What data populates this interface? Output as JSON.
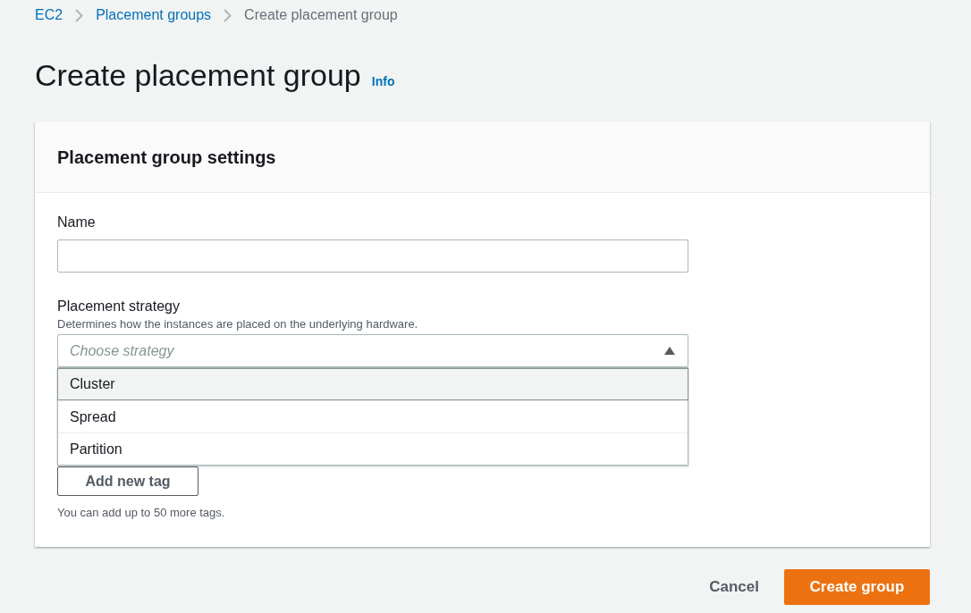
{
  "breadcrumb": [
    {
      "label": "EC2",
      "link": true
    },
    {
      "label": "Placement groups",
      "link": true
    },
    {
      "label": "Create placement group",
      "link": false
    }
  ],
  "title": "Create placement group",
  "info_link": "Info",
  "panel": {
    "title": "Placement group settings",
    "name_field": {
      "label": "Name"
    },
    "strategy_field": {
      "label": "Placement strategy",
      "description": "Determines how the instances are placed on the underlying hardware.",
      "placeholder": "Choose strategy",
      "expanded": true,
      "options": [
        {
          "label": "Cluster",
          "selected": true
        },
        {
          "label": "Spread",
          "selected": false
        },
        {
          "label": "Partition",
          "selected": false
        }
      ]
    },
    "add_tag_button": "Add new tag",
    "tags_hint": "You can add up to 50 more tags."
  },
  "buttons": {
    "cancel": "Cancel",
    "submit": "Create group"
  }
}
